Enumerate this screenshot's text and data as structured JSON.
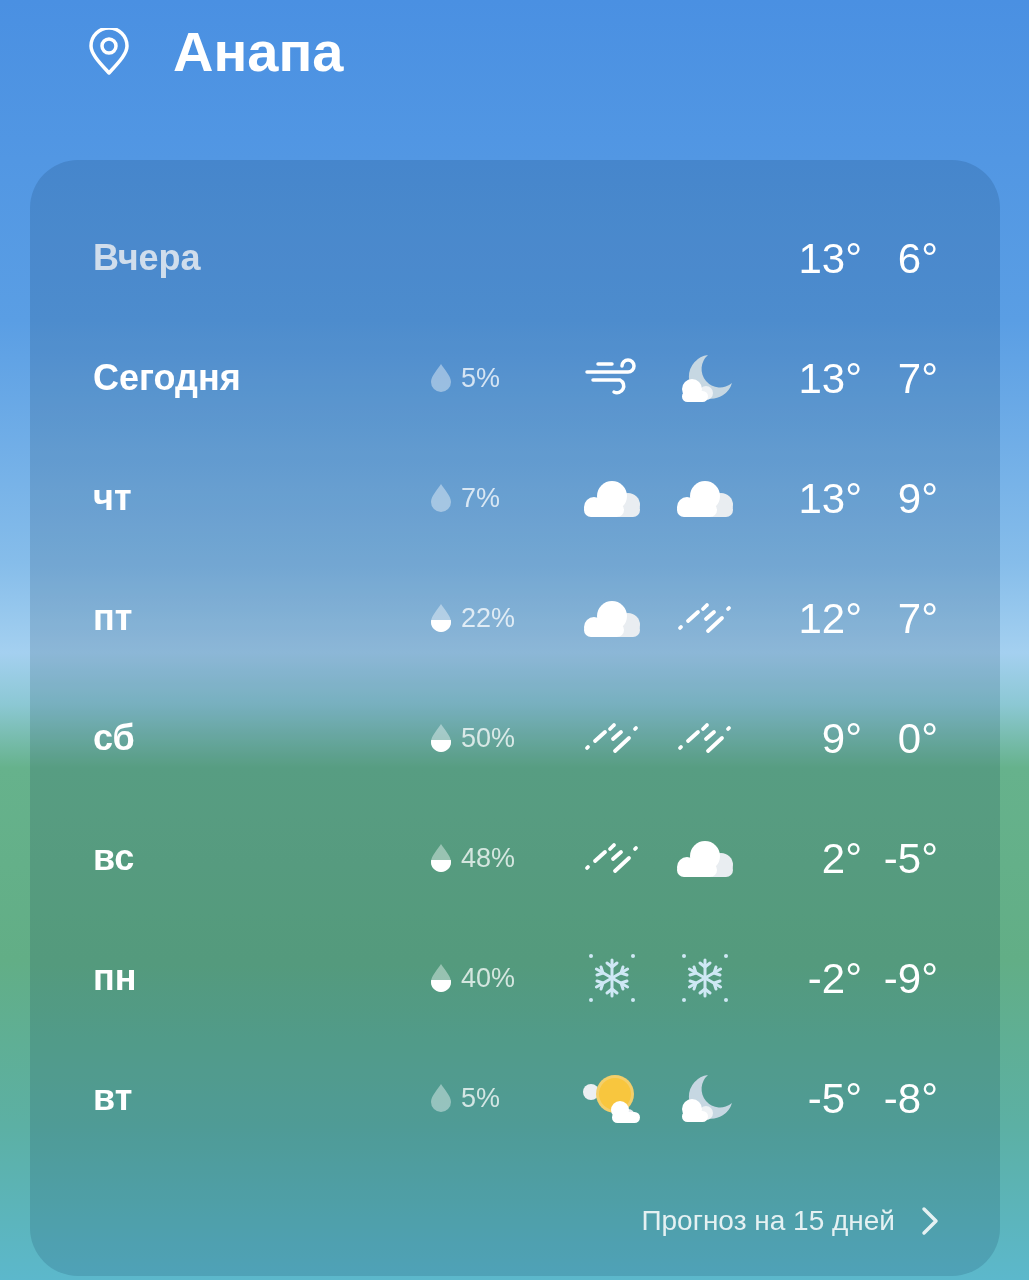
{
  "header": {
    "city": "Анапа"
  },
  "forecast": {
    "days": [
      {
        "label": "Вчера",
        "past": true,
        "high": "13°",
        "low": "6°"
      },
      {
        "label": "Сегодня",
        "past": false,
        "precip": {
          "kind": "light",
          "value": "5%"
        },
        "day_icon": {
          "kind": "wind"
        },
        "night_icon": {
          "kind": "moon"
        },
        "high": "13°",
        "low": "7°"
      },
      {
        "label": "чт",
        "past": false,
        "precip": {
          "kind": "light",
          "value": "7%"
        },
        "day_icon": {
          "kind": "cloud"
        },
        "night_icon": {
          "kind": "cloud"
        },
        "high": "13°",
        "low": "9°"
      },
      {
        "label": "пт",
        "past": false,
        "precip": {
          "kind": "half",
          "value": "22%"
        },
        "day_icon": {
          "kind": "cloud"
        },
        "night_icon": {
          "kind": "rain"
        },
        "high": "12°",
        "low": "7°"
      },
      {
        "label": "сб",
        "past": false,
        "precip": {
          "kind": "half",
          "value": "50%"
        },
        "day_icon": {
          "kind": "rain"
        },
        "night_icon": {
          "kind": "rain"
        },
        "high": "9°",
        "low": "0°"
      },
      {
        "label": "вс",
        "past": false,
        "precip": {
          "kind": "half",
          "value": "48%"
        },
        "day_icon": {
          "kind": "rain"
        },
        "night_icon": {
          "kind": "cloud"
        },
        "high": "2°",
        "low": "-5°"
      },
      {
        "label": "пн",
        "past": false,
        "precip": {
          "kind": "half",
          "value": "40%"
        },
        "day_icon": {
          "kind": "snow"
        },
        "night_icon": {
          "kind": "snow"
        },
        "high": "-2°",
        "low": "-9°"
      },
      {
        "label": "вт",
        "past": false,
        "precip": {
          "kind": "light",
          "value": "5%"
        },
        "day_icon": {
          "kind": "sun"
        },
        "night_icon": {
          "kind": "moon"
        },
        "high": "-5°",
        "low": "-8°"
      }
    ],
    "more_link": "Прогноз на 15 дней"
  }
}
